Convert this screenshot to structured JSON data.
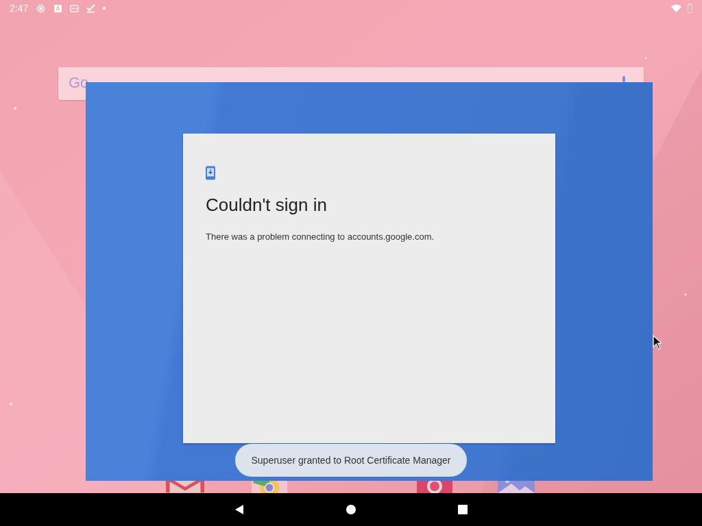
{
  "status_bar": {
    "time": "2:47"
  },
  "search_widget": {
    "logo": "Go"
  },
  "dialog": {
    "title": "Couldn't sign in",
    "message": "There was a problem connecting to accounts.google.com."
  },
  "toast": {
    "text": "Superuser granted to Root Certificate Manager"
  }
}
